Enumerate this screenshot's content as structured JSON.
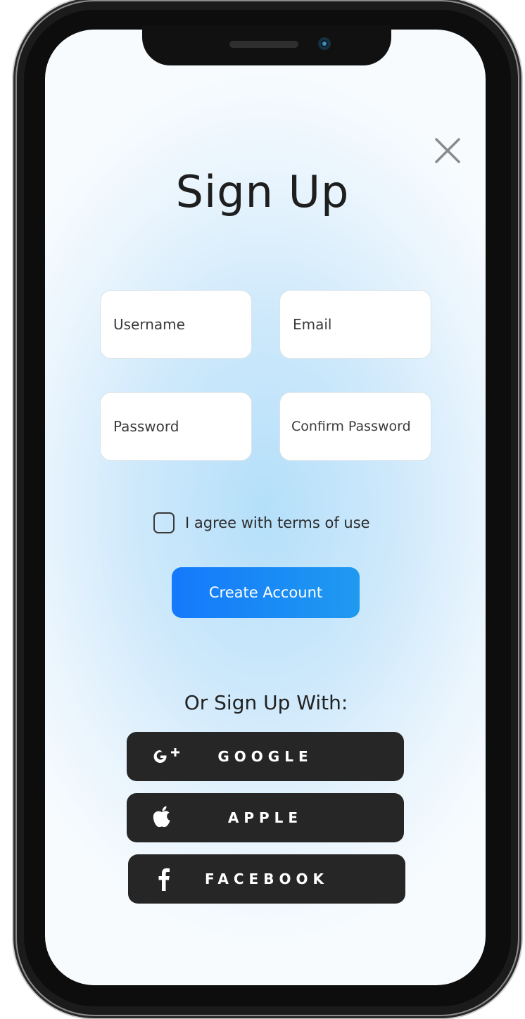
{
  "title": "Sign Up",
  "fields": {
    "username_placeholder": "Username",
    "email_placeholder": "Email",
    "password_placeholder": "Password",
    "confirm_placeholder": "Confirm Password"
  },
  "terms": {
    "label": "I agree with terms of use",
    "checked": false
  },
  "create_button": "Create Account",
  "or_label": "Or Sign Up With:",
  "social": [
    {
      "label": "GOOGLE",
      "icon": "google-plus-icon"
    },
    {
      "label": "APPLE",
      "icon": "apple-icon"
    },
    {
      "label": "FACEBOOK",
      "icon": "facebook-icon"
    }
  ],
  "colors": {
    "accent_start": "#1479fb",
    "accent_end": "#1f9af0",
    "social_button": "#262626",
    "background_center": "#b4dffa"
  }
}
